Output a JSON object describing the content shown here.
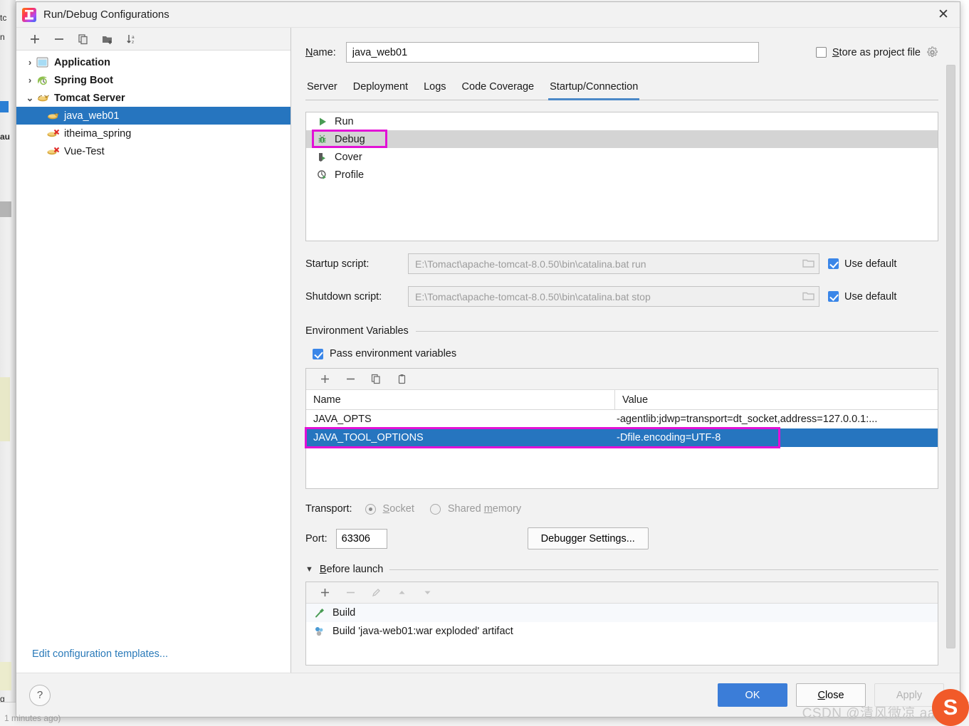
{
  "window": {
    "title": "Run/Debug Configurations",
    "close_label": "✕",
    "app_icon": "intellij-idea-icon"
  },
  "left_panel": {
    "toolbar": [
      {
        "name": "add-configuration-button",
        "icon": "plus-icon"
      },
      {
        "name": "remove-configuration-button",
        "icon": "minus-icon"
      },
      {
        "name": "copy-configuration-button",
        "icon": "copy-icon"
      },
      {
        "name": "new-folder-button",
        "icon": "folder-add-icon"
      },
      {
        "name": "sort-configurations-button",
        "icon": "sort-alpha-icon"
      }
    ],
    "tree": [
      {
        "label": "Application",
        "level": 0,
        "expanded": false,
        "twisty": "›",
        "icon": "application-icon",
        "selected": false,
        "invalid": false
      },
      {
        "label": "Spring Boot",
        "level": 0,
        "expanded": false,
        "twisty": "›",
        "icon": "spring-boot-icon",
        "selected": false,
        "invalid": false
      },
      {
        "label": "Tomcat Server",
        "level": 0,
        "expanded": true,
        "twisty": "⌄",
        "icon": "tomcat-icon",
        "selected": false,
        "invalid": false
      },
      {
        "label": "java_web01",
        "level": 1,
        "expanded": null,
        "twisty": "",
        "icon": "tomcat-icon",
        "selected": true,
        "invalid": false
      },
      {
        "label": "itheima_spring",
        "level": 1,
        "expanded": null,
        "twisty": "",
        "icon": "tomcat-icon",
        "selected": false,
        "invalid": true
      },
      {
        "label": "Vue-Test",
        "level": 1,
        "expanded": null,
        "twisty": "",
        "icon": "tomcat-icon",
        "selected": false,
        "invalid": true
      }
    ],
    "edit_templates_link": "Edit configuration templates..."
  },
  "main": {
    "name_label": "Name:",
    "name_value": "java_web01",
    "store_as_project_file_label": "Store as project file",
    "store_as_project_file_checked": false,
    "store_gear_icon": "gear-icon",
    "tabs": [
      {
        "label": "Server",
        "active": false
      },
      {
        "label": "Deployment",
        "active": false
      },
      {
        "label": "Logs",
        "active": false
      },
      {
        "label": "Code Coverage",
        "active": false
      },
      {
        "label": "Startup/Connection",
        "active": true
      }
    ],
    "run_modes": [
      {
        "label": "Run",
        "icon": "run-play-icon",
        "selected": false,
        "annotated": false
      },
      {
        "label": "Debug",
        "icon": "debug-bug-icon",
        "selected": true,
        "annotated": true
      },
      {
        "label": "Cover",
        "icon": "coverage-icon",
        "selected": false,
        "annotated": false
      },
      {
        "label": "Profile",
        "icon": "profile-icon",
        "selected": false,
        "annotated": false
      }
    ],
    "startup_script": {
      "label": "Startup script:",
      "value": "E:\\Tomact\\apache-tomcat-8.0.50\\bin\\catalina.bat run",
      "browse_icon": "folder-browse-icon",
      "use_default_label": "Use default",
      "use_default_checked": true
    },
    "shutdown_script": {
      "label": "Shutdown script:",
      "value": "E:\\Tomact\\apache-tomcat-8.0.50\\bin\\catalina.bat stop",
      "browse_icon": "folder-browse-icon",
      "use_default_label": "Use default",
      "use_default_checked": true
    },
    "environment": {
      "section_title": "Environment Variables",
      "pass_env_label": "Pass environment variables",
      "pass_env_checked": true,
      "toolbar": [
        {
          "name": "env-add-button",
          "icon": "plus-icon"
        },
        {
          "name": "env-remove-button",
          "icon": "minus-icon"
        },
        {
          "name": "env-copy-button",
          "icon": "copy-icon"
        },
        {
          "name": "env-paste-button",
          "icon": "clipboard-icon"
        }
      ],
      "columns": [
        "Name",
        "Value"
      ],
      "rows": [
        {
          "name": "JAVA_OPTS",
          "value": "-agentlib:jdwp=transport=dt_socket,address=127.0.0.1:...",
          "selected": false,
          "annotated": false
        },
        {
          "name": "JAVA_TOOL_OPTIONS",
          "value": "-Dfile.encoding=UTF-8",
          "selected": true,
          "annotated": true
        }
      ]
    },
    "transport": {
      "label": "Transport:",
      "options": [
        {
          "label": "Socket",
          "selected": true,
          "underline_char": "S"
        },
        {
          "label": "Shared memory",
          "selected": false,
          "underline_char": "m"
        }
      ]
    },
    "port": {
      "label": "Port:",
      "value": "63306"
    },
    "debugger_settings_button": "Debugger Settings...",
    "before_launch": {
      "title": "Before launch",
      "collapse_icon": "triangle-down-icon",
      "toolbar": [
        {
          "name": "before-launch-add-button",
          "icon": "plus-icon",
          "enabled": true
        },
        {
          "name": "before-launch-remove-button",
          "icon": "minus-icon",
          "enabled": false
        },
        {
          "name": "before-launch-edit-button",
          "icon": "pencil-icon",
          "enabled": false
        },
        {
          "name": "before-launch-move-up-button",
          "icon": "arrow-up-icon",
          "enabled": false
        },
        {
          "name": "before-launch-move-down-button",
          "icon": "arrow-down-icon",
          "enabled": false
        }
      ],
      "items": [
        {
          "label": "Build",
          "icon": "build-hammer-icon"
        },
        {
          "label": "Build 'java-web01:war exploded' artifact",
          "icon": "artifact-icon"
        }
      ]
    }
  },
  "footer": {
    "help_label": "?",
    "buttons": [
      {
        "label": "OK",
        "style": "primary",
        "enabled": true
      },
      {
        "label": "Close",
        "style": "normal",
        "enabled": true,
        "underline_char": "C"
      },
      {
        "label": "Apply",
        "style": "disabled",
        "enabled": false
      }
    ]
  },
  "watermark": {
    "text": "CSDN @清风微凉 aaa",
    "badge": "S"
  },
  "colors": {
    "accent_blue": "#2675bf",
    "primary_button": "#3b7dd8",
    "annotation_magenta": "#e211d6",
    "tab_underline": "#4a88c7",
    "selection_grey": "#d4d4d4",
    "link_blue": "#2a7ab9"
  }
}
